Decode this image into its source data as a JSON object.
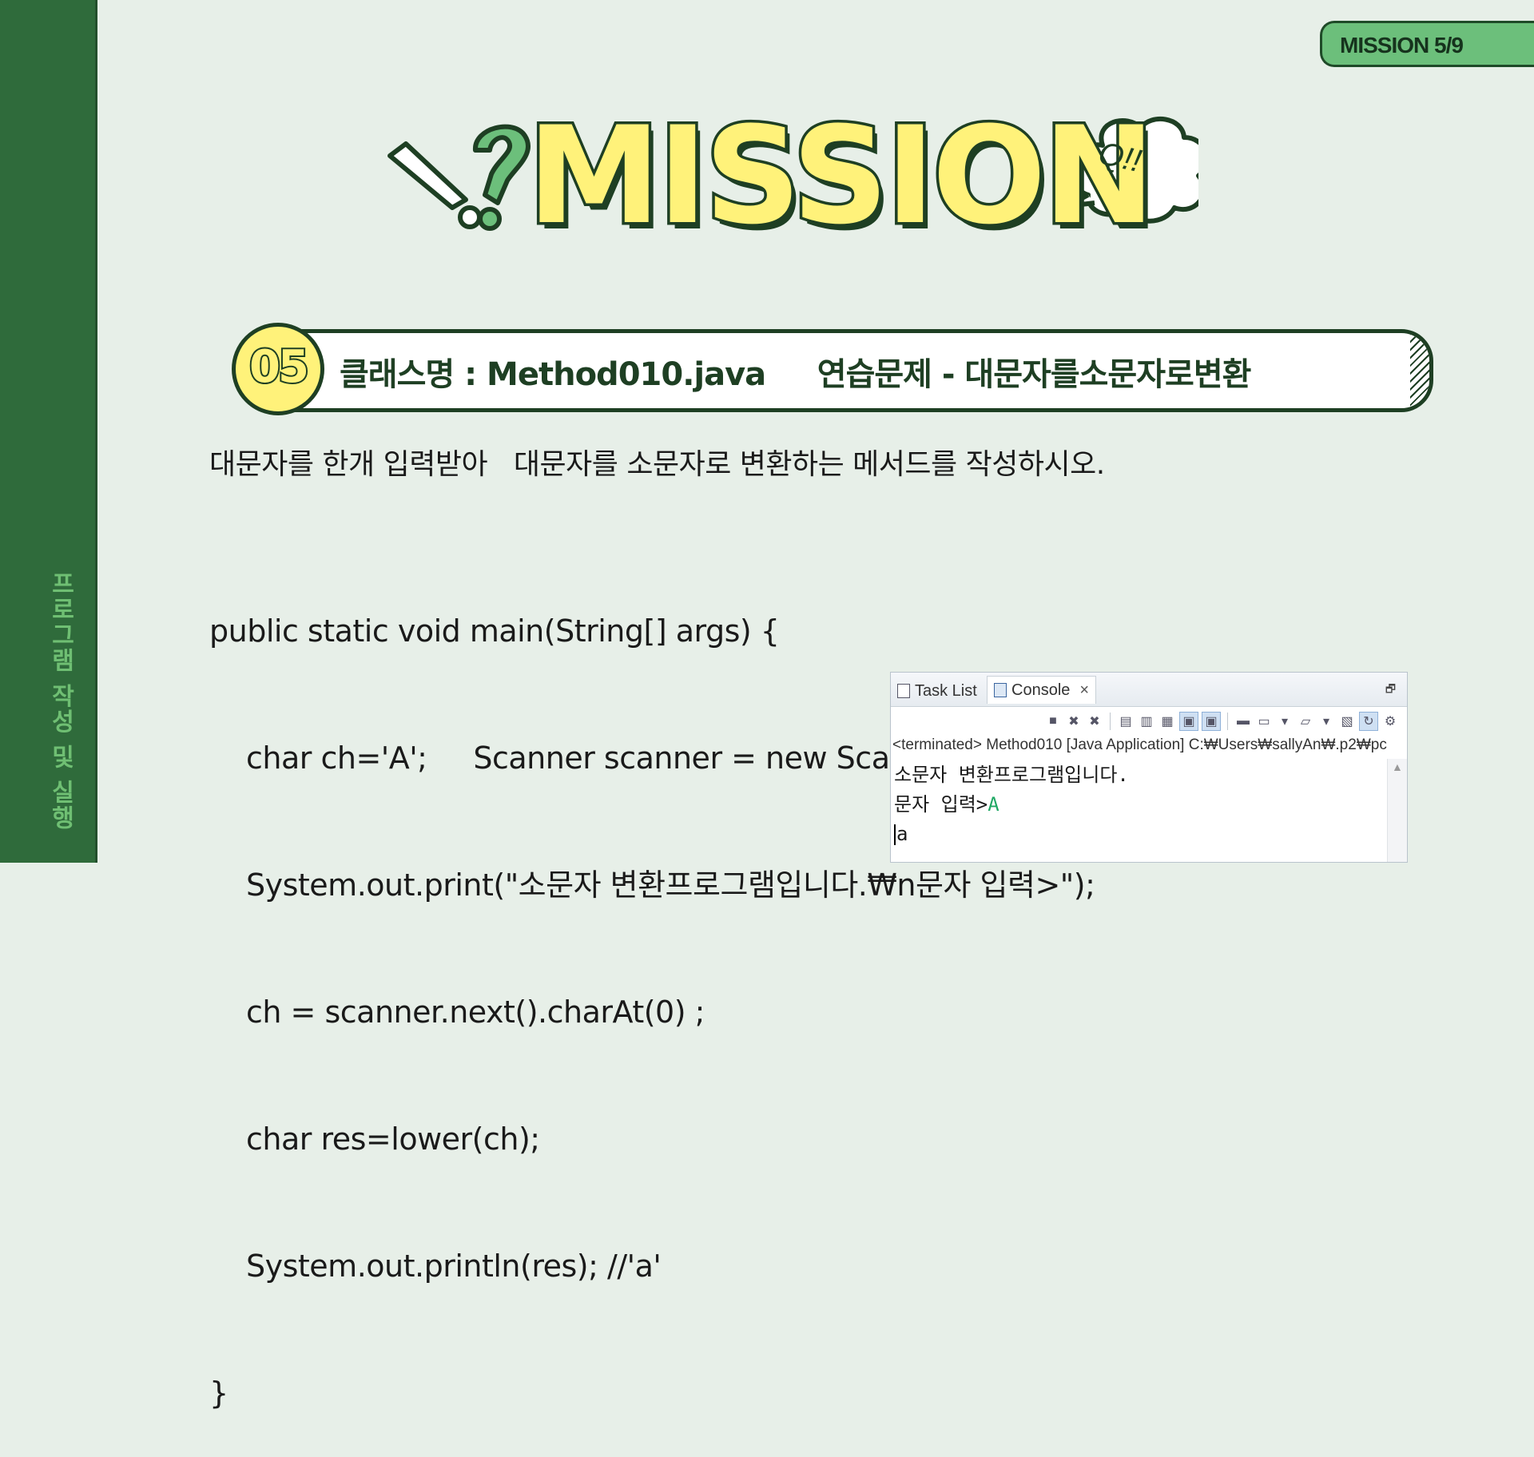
{
  "sidebar": {
    "vertical_label": "프로그램 작성 및 실행"
  },
  "badge": {
    "label": "MISSION 5/9"
  },
  "title": {
    "text": "MISSION",
    "bubble": "Q!!"
  },
  "task": {
    "number": "05",
    "heading": "클래스명 : Method010.java     연습문제 - 대문자를소문자로변환"
  },
  "description": "대문자를 한개 입력받아   대문자를 소문자로 변환하는 메서드를 작성하시오.",
  "code": {
    "lines": [
      "public static void main(String[] args) {",
      "char ch='A';     Scanner scanner = new Scanner(System.in);",
      "System.out.print(\"소문자 변환프로그램입니다.₩n문자 입력>\");",
      "ch = scanner.next().charAt(0) ;",
      "char res=lower(ch);",
      "System.out.println(res); //'a'",
      "}"
    ]
  },
  "console": {
    "tabs": [
      {
        "label": "Task List",
        "icon": "task-list-icon"
      },
      {
        "label": "Console",
        "icon": "console-icon"
      }
    ],
    "status": "<terminated> Method010 [Java Application] C:₩Users₩sallyAn₩.p2₩pc",
    "output": {
      "line1": "소문자 변환프로그램입니다.",
      "prompt": "문자 입력>",
      "input": "A",
      "result": "a"
    }
  },
  "colors": {
    "sidebar": "#2f6b3b",
    "background": "#e7efe8",
    "accent_yellow": "#fff27a",
    "dark_green": "#1e3f23",
    "badge_green": "#6cbf7b",
    "console_input": "#1fa864"
  }
}
